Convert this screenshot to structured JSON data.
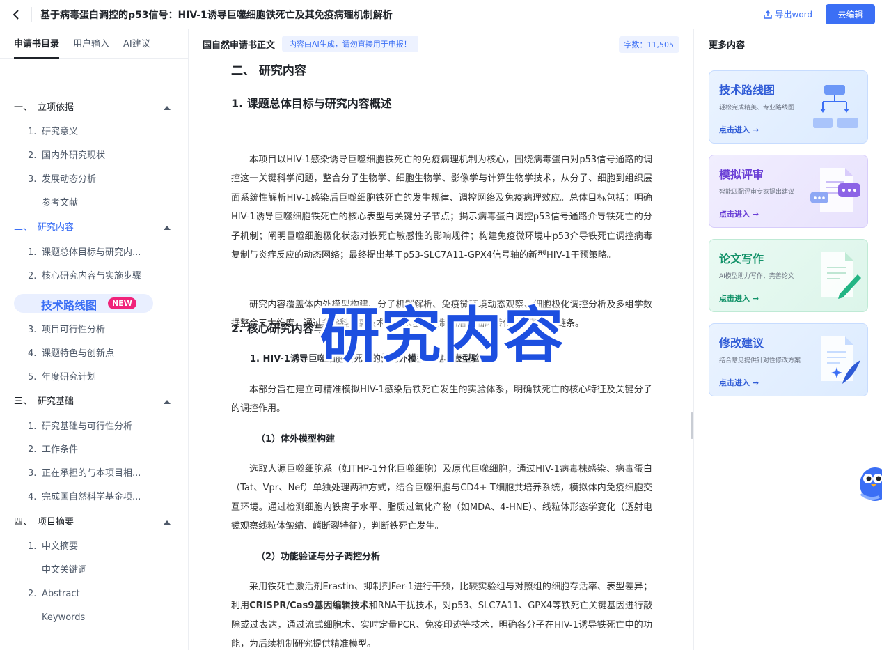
{
  "header": {
    "title": "基于病毒蛋白调控的p53信号：HIV-1诱导巨噬细胞铁死亡及其免疫病理机制解析",
    "export_label": "导出word",
    "edit_label": "去编辑"
  },
  "left_tabs": [
    "申请书目录",
    "用户输入",
    "AI建议"
  ],
  "toc": {
    "s1_num": "一、",
    "s1_label": "立项依据",
    "s1_i1_num": "1.",
    "s1_i1_label": "研究意义",
    "s1_i2_num": "2.",
    "s1_i2_label": "国内外研究现状",
    "s1_i3_num": "3.",
    "s1_i3_label": "发展动态分析",
    "s1_i4_label": "参考文献",
    "s2_num": "二、",
    "s2_label": "研究内容",
    "s2_i1_num": "1.",
    "s2_i1_label": "课题总体目标与研究内...",
    "s2_i2_num": "2.",
    "s2_i2_label": "核心研究内容与实施步骤",
    "s2_special_label": "技术路线图",
    "s2_special_badge": "NEW",
    "s2_i3_num": "3.",
    "s2_i3_label": "项目可行性分析",
    "s2_i4_num": "4.",
    "s2_i4_label": "课题特色与创新点",
    "s2_i5_num": "5.",
    "s2_i5_label": "年度研究计划",
    "s3_num": "三、",
    "s3_label": "研究基础",
    "s3_i1_num": "1.",
    "s3_i1_label": "研究基础与可行性分析",
    "s3_i2_num": "2.",
    "s3_i2_label": "工作条件",
    "s3_i3_num": "3.",
    "s3_i3_label": "正在承担的与本项目相...",
    "s3_i4_num": "4.",
    "s3_i4_label": "完成国自然科学基金项...",
    "s4_num": "四、",
    "s4_label": "项目摘要",
    "s4_i1_num": "1.",
    "s4_i1_label": "中文摘要",
    "s4_i2_label": "中文关键词",
    "s4_i3_num": "2.",
    "s4_i3_label": "Abstract",
    "s4_i4_label": "Keywords"
  },
  "center": {
    "title": "国自然申请书正文",
    "ai_tip": "内容由AI生成，请勿直接用于申报！",
    "word_count": "字数：11,505"
  },
  "doc": {
    "h1": "二、 研究内容",
    "h2_1": "1. 课题总体目标与研究内容概述",
    "p1": "本项目以HIV-1感染诱导巨噬细胞铁死亡的免疫病理机制为核心，围绕病毒蛋白对p53信号通路的调控这一关键科学问题，整合分子生物学、细胞生物学、影像学与计算生物学技术，从分子、细胞到组织层面系统性解析HIV-1感染后巨噬细胞铁死亡的发生规律、调控网络及免疫病理效应。总体目标包括：明确HIV-1诱导巨噬细胞铁死亡的核心表型与关键分子节点；揭示病毒蛋白调控p53信号通路介导铁死亡的分子机制；阐明巨噬细胞极化状态对铁死亡敏感性的影响规律；构建免疫微环境中p53介导铁死亡调控病毒复制与炎症反应的动态网络；最终提出基于p53-SLC7A11-GPX4信号轴的新型HIV-1干预策略。",
    "p2": "研究内容覆盖体内外模型构建、分子机制解析、免疫微环境动态观察、细胞极化调控分析及多组学数据整合五大维度，通过多学科交叉技术实现从基础机制到潜在临床转化的完整研究链条。",
    "h2_2": "2. 核心研究内容与实施步骤",
    "h3_1": "1. HIV-1诱导巨噬细胞铁死亡的体内外模型构建与表型验证",
    "p3": "本部分旨在建立可精准模拟HIV-1感染后铁死亡发生的实验体系，明确铁死亡的核心特征及关键分子的调控作用。",
    "h4_1": "（1）体外模型构建",
    "p4": "选取人源巨噬细胞系（如THP-1分化巨噬细胞）及原代巨噬细胞，通过HIV-1病毒株感染、病毒蛋白（Tat、Vpr、Nef）单独处理两种方式，结合巨噬细胞与CD4+ T细胞共培养系统，模拟体内免疫细胞交互环境。通过检测细胞内铁离子水平、脂质过氧化产物（如MDA、4-HNE）、线粒体形态学变化（透射电镜观察线粒体皱缩、嵴断裂特征），判断铁死亡发生。",
    "h4_2": "（2）功能验证与分子调控分析",
    "p5a": "采用铁死亡激活剂Erastin、抑制剂Fer-1进行干预，比较实验组与对照组的细胞存活率、表型差异；利用",
    "p5b": "CRISPR/Cas9基因编辑技术",
    "p5c": "和RNA干扰技术，对p53、SLC7A11、GPX4等铁死亡关键基因进行敲除或过表达，通过流式细胞术、实时定量PCR、免疫印迹等技术，明确各分子在HIV-1诱导铁死亡中的功能，为后续机制研究提供精准模型。"
  },
  "overlay_text": "研究内容",
  "right": {
    "title": "更多内容",
    "cards": [
      {
        "title": "技术路线图",
        "sub": "轻松完成精美、专业路线图",
        "go": "点击进入 →"
      },
      {
        "title": "模拟评审",
        "sub": "智能匹配评审专家提出建议",
        "go": "点击进入 →"
      },
      {
        "title": "论文写作",
        "sub": "AI模型助力写作，完善论文",
        "go": "点击进入 →"
      },
      {
        "title": "修改建议",
        "sub": "结合意见提供针对性修改方案",
        "go": "点击进入 →"
      }
    ]
  },
  "colors": {
    "accent": "#3b6ff5",
    "new_badge": "#f0247a",
    "overlay": "#1d4fe0"
  }
}
